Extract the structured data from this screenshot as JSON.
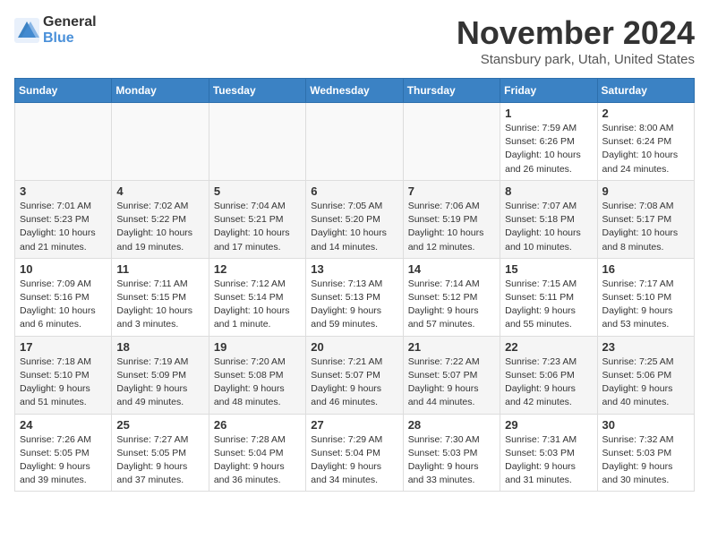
{
  "logo": {
    "general": "General",
    "blue": "Blue"
  },
  "header": {
    "month": "November 2024",
    "location": "Stansbury park, Utah, United States"
  },
  "weekdays": [
    "Sunday",
    "Monday",
    "Tuesday",
    "Wednesday",
    "Thursday",
    "Friday",
    "Saturday"
  ],
  "weeks": [
    [
      {
        "day": "",
        "info": ""
      },
      {
        "day": "",
        "info": ""
      },
      {
        "day": "",
        "info": ""
      },
      {
        "day": "",
        "info": ""
      },
      {
        "day": "",
        "info": ""
      },
      {
        "day": "1",
        "info": "Sunrise: 7:59 AM\nSunset: 6:26 PM\nDaylight: 10 hours and 26 minutes."
      },
      {
        "day": "2",
        "info": "Sunrise: 8:00 AM\nSunset: 6:24 PM\nDaylight: 10 hours and 24 minutes."
      }
    ],
    [
      {
        "day": "3",
        "info": "Sunrise: 7:01 AM\nSunset: 5:23 PM\nDaylight: 10 hours and 21 minutes."
      },
      {
        "day": "4",
        "info": "Sunrise: 7:02 AM\nSunset: 5:22 PM\nDaylight: 10 hours and 19 minutes."
      },
      {
        "day": "5",
        "info": "Sunrise: 7:04 AM\nSunset: 5:21 PM\nDaylight: 10 hours and 17 minutes."
      },
      {
        "day": "6",
        "info": "Sunrise: 7:05 AM\nSunset: 5:20 PM\nDaylight: 10 hours and 14 minutes."
      },
      {
        "day": "7",
        "info": "Sunrise: 7:06 AM\nSunset: 5:19 PM\nDaylight: 10 hours and 12 minutes."
      },
      {
        "day": "8",
        "info": "Sunrise: 7:07 AM\nSunset: 5:18 PM\nDaylight: 10 hours and 10 minutes."
      },
      {
        "day": "9",
        "info": "Sunrise: 7:08 AM\nSunset: 5:17 PM\nDaylight: 10 hours and 8 minutes."
      }
    ],
    [
      {
        "day": "10",
        "info": "Sunrise: 7:09 AM\nSunset: 5:16 PM\nDaylight: 10 hours and 6 minutes."
      },
      {
        "day": "11",
        "info": "Sunrise: 7:11 AM\nSunset: 5:15 PM\nDaylight: 10 hours and 3 minutes."
      },
      {
        "day": "12",
        "info": "Sunrise: 7:12 AM\nSunset: 5:14 PM\nDaylight: 10 hours and 1 minute."
      },
      {
        "day": "13",
        "info": "Sunrise: 7:13 AM\nSunset: 5:13 PM\nDaylight: 9 hours and 59 minutes."
      },
      {
        "day": "14",
        "info": "Sunrise: 7:14 AM\nSunset: 5:12 PM\nDaylight: 9 hours and 57 minutes."
      },
      {
        "day": "15",
        "info": "Sunrise: 7:15 AM\nSunset: 5:11 PM\nDaylight: 9 hours and 55 minutes."
      },
      {
        "day": "16",
        "info": "Sunrise: 7:17 AM\nSunset: 5:10 PM\nDaylight: 9 hours and 53 minutes."
      }
    ],
    [
      {
        "day": "17",
        "info": "Sunrise: 7:18 AM\nSunset: 5:10 PM\nDaylight: 9 hours and 51 minutes."
      },
      {
        "day": "18",
        "info": "Sunrise: 7:19 AM\nSunset: 5:09 PM\nDaylight: 9 hours and 49 minutes."
      },
      {
        "day": "19",
        "info": "Sunrise: 7:20 AM\nSunset: 5:08 PM\nDaylight: 9 hours and 48 minutes."
      },
      {
        "day": "20",
        "info": "Sunrise: 7:21 AM\nSunset: 5:07 PM\nDaylight: 9 hours and 46 minutes."
      },
      {
        "day": "21",
        "info": "Sunrise: 7:22 AM\nSunset: 5:07 PM\nDaylight: 9 hours and 44 minutes."
      },
      {
        "day": "22",
        "info": "Sunrise: 7:23 AM\nSunset: 5:06 PM\nDaylight: 9 hours and 42 minutes."
      },
      {
        "day": "23",
        "info": "Sunrise: 7:25 AM\nSunset: 5:06 PM\nDaylight: 9 hours and 40 minutes."
      }
    ],
    [
      {
        "day": "24",
        "info": "Sunrise: 7:26 AM\nSunset: 5:05 PM\nDaylight: 9 hours and 39 minutes."
      },
      {
        "day": "25",
        "info": "Sunrise: 7:27 AM\nSunset: 5:05 PM\nDaylight: 9 hours and 37 minutes."
      },
      {
        "day": "26",
        "info": "Sunrise: 7:28 AM\nSunset: 5:04 PM\nDaylight: 9 hours and 36 minutes."
      },
      {
        "day": "27",
        "info": "Sunrise: 7:29 AM\nSunset: 5:04 PM\nDaylight: 9 hours and 34 minutes."
      },
      {
        "day": "28",
        "info": "Sunrise: 7:30 AM\nSunset: 5:03 PM\nDaylight: 9 hours and 33 minutes."
      },
      {
        "day": "29",
        "info": "Sunrise: 7:31 AM\nSunset: 5:03 PM\nDaylight: 9 hours and 31 minutes."
      },
      {
        "day": "30",
        "info": "Sunrise: 7:32 AM\nSunset: 5:03 PM\nDaylight: 9 hours and 30 minutes."
      }
    ]
  ]
}
